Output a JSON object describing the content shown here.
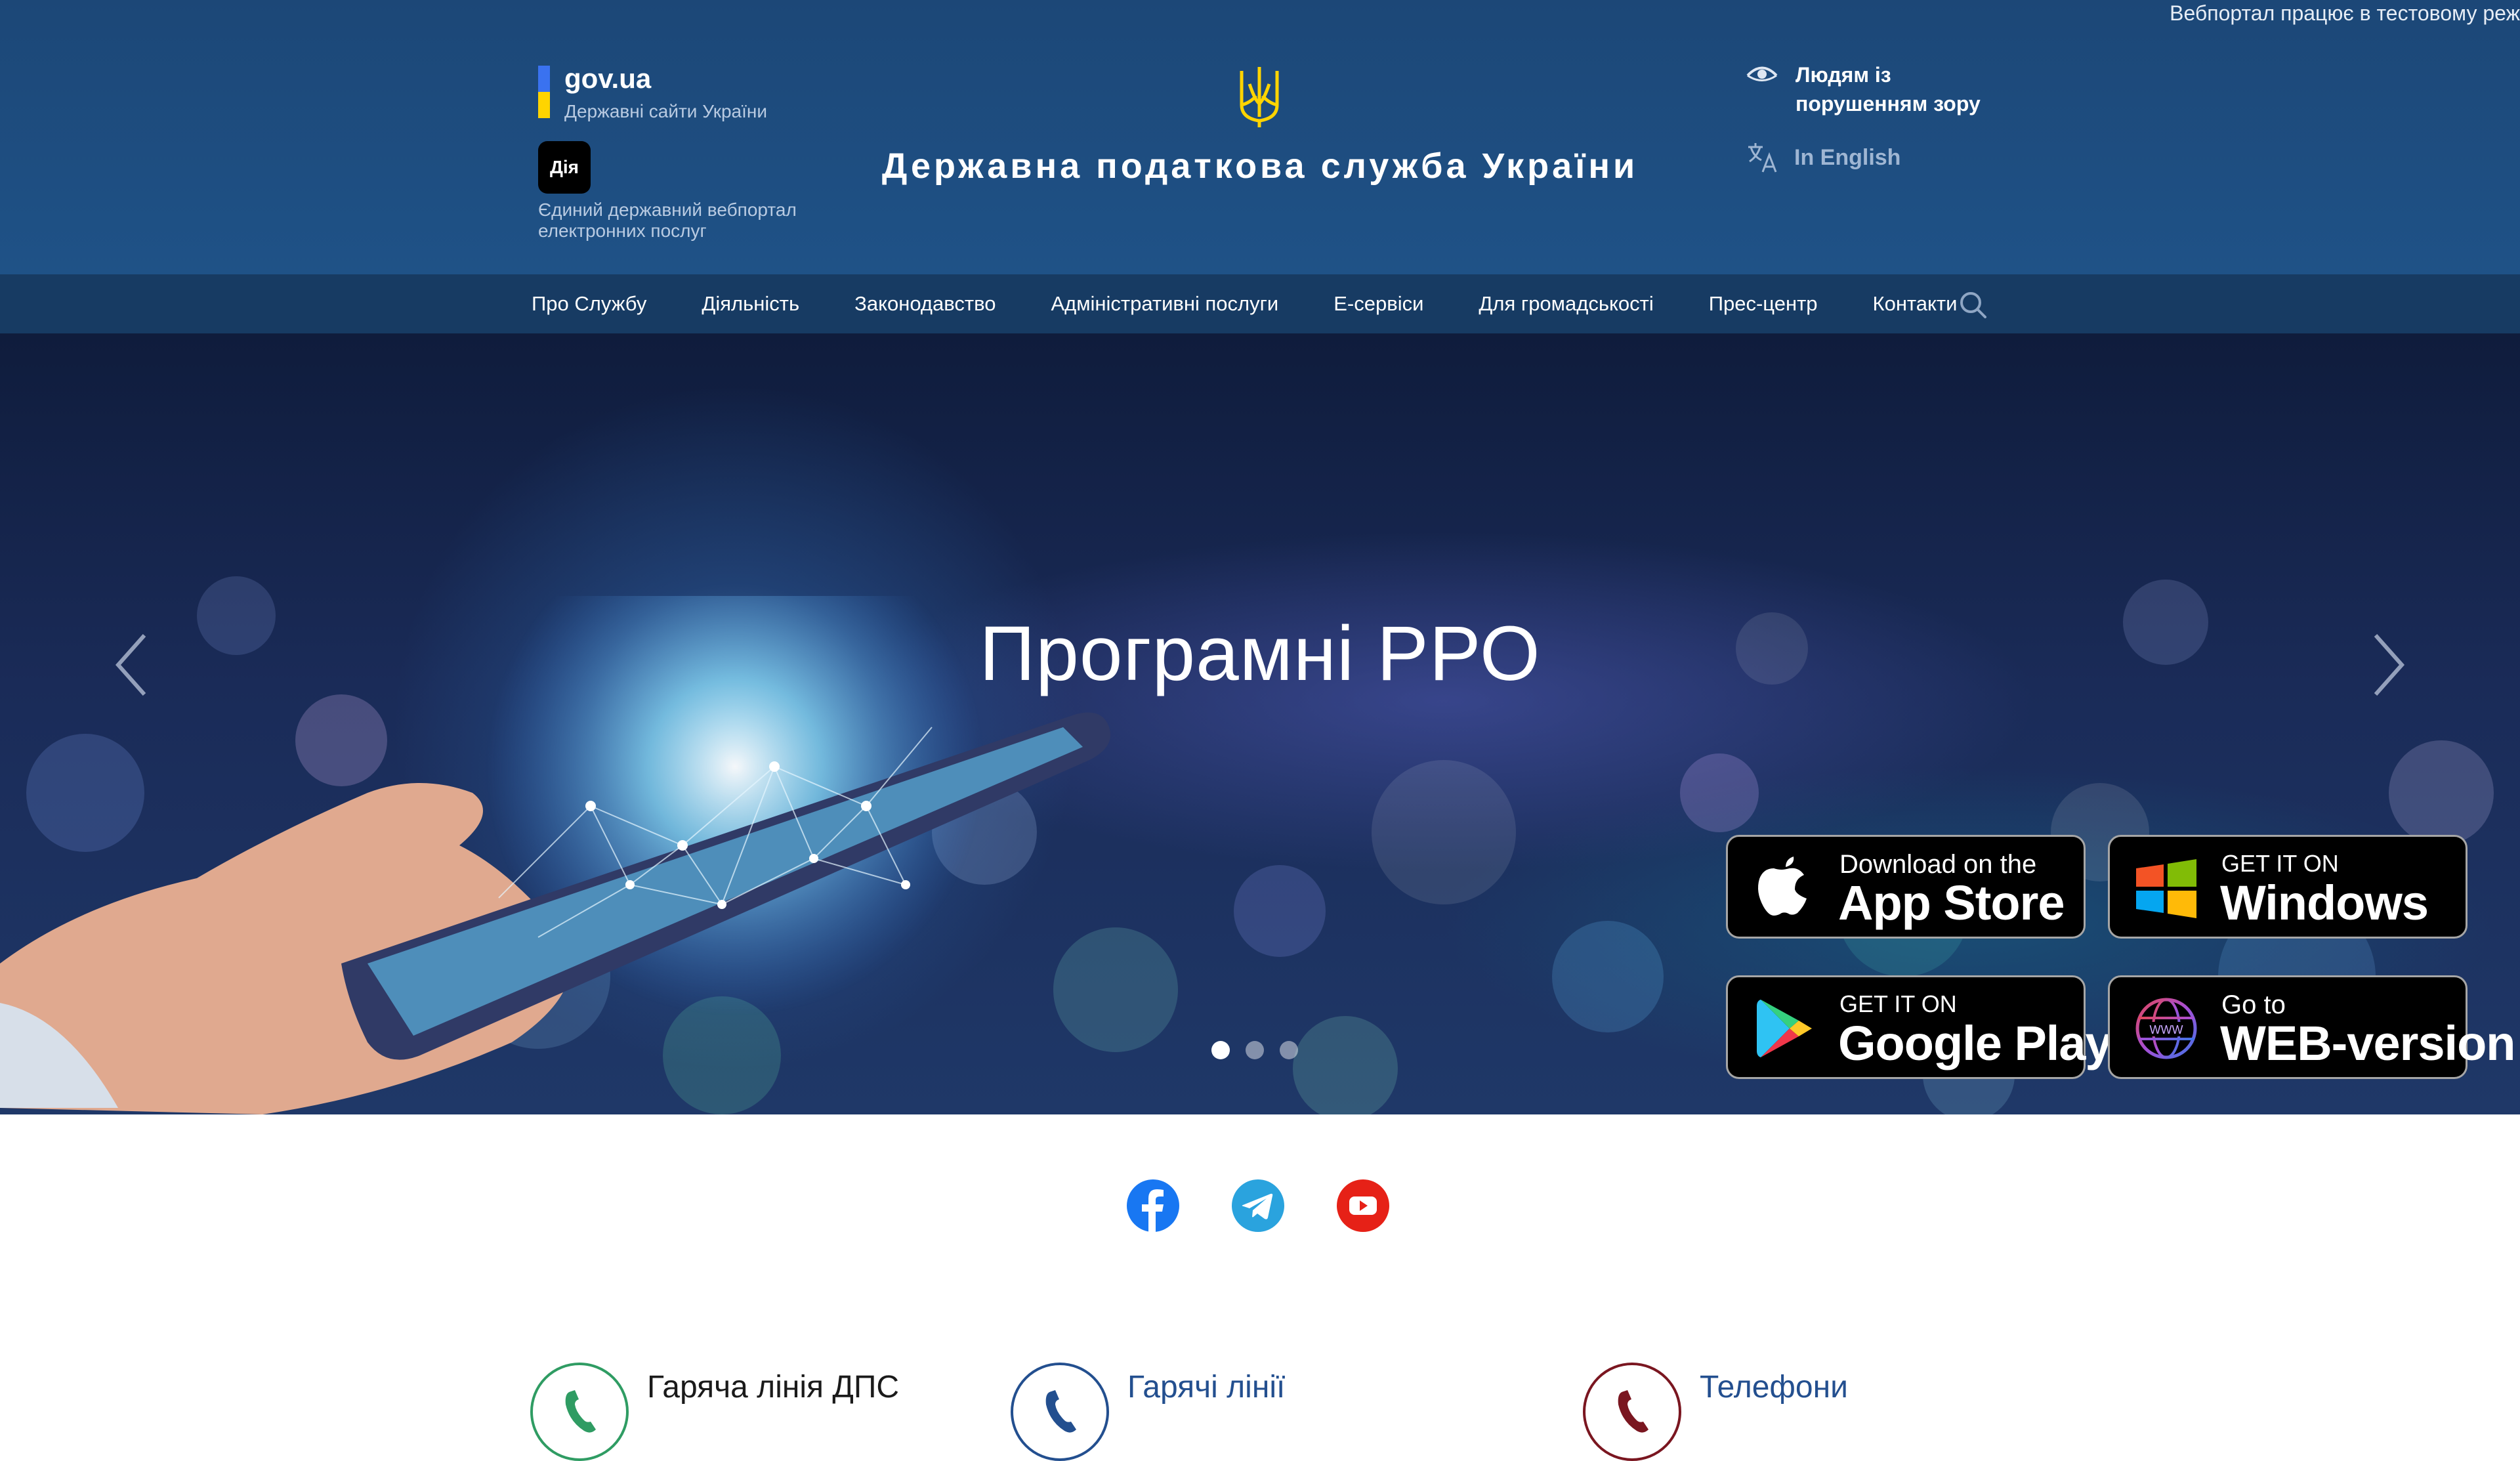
{
  "ticker": "Вебпортал працює в тестовому реж",
  "govua": {
    "name": "gov.ua",
    "subtitle": "Державні сайти України"
  },
  "diia": {
    "logo_text": "Дія",
    "caption": "Єдиний державний вебпортал електронних послуг"
  },
  "site_title": "Державна податкова служба України",
  "accessibility": {
    "label": "Людям із порушенням зору"
  },
  "language": {
    "label": "In English"
  },
  "nav": {
    "items": [
      {
        "label": "Про Службу"
      },
      {
        "label": "Діяльність"
      },
      {
        "label": "Законодавство"
      },
      {
        "label": "Адміністративні послуги"
      },
      {
        "label": "Е-сервіси"
      },
      {
        "label": "Для громадськості"
      },
      {
        "label": "Прес-центр"
      },
      {
        "label": "Контакти"
      }
    ],
    "search_icon": "search-icon"
  },
  "hero": {
    "title": "Програмні РРО",
    "slides_total": 3,
    "active_slide": 1,
    "stores": [
      {
        "small": "Download on the",
        "big": "App Store",
        "icon": "apple-icon"
      },
      {
        "small": "GET IT ON",
        "big": "Windows",
        "icon": "windows-icon"
      },
      {
        "small": "GET IT ON",
        "big": "Google Play",
        "icon": "google-play-icon"
      },
      {
        "small": "Go to",
        "big": "WEB-version",
        "icon": "globe-www-icon"
      }
    ]
  },
  "socials": [
    "facebook-icon",
    "telegram-icon",
    "youtube-icon"
  ],
  "contacts": [
    {
      "label": "Гаряча лінія ДПС",
      "color": "#2f9c63"
    },
    {
      "label": "Гарячі лінії",
      "color": "#234f8f"
    },
    {
      "label": "Телефони",
      "color": "#7a1620"
    }
  ],
  "colors": {
    "header": "#1f5287",
    "nav": "#173b63",
    "accent_yellow": "#ffd400"
  }
}
